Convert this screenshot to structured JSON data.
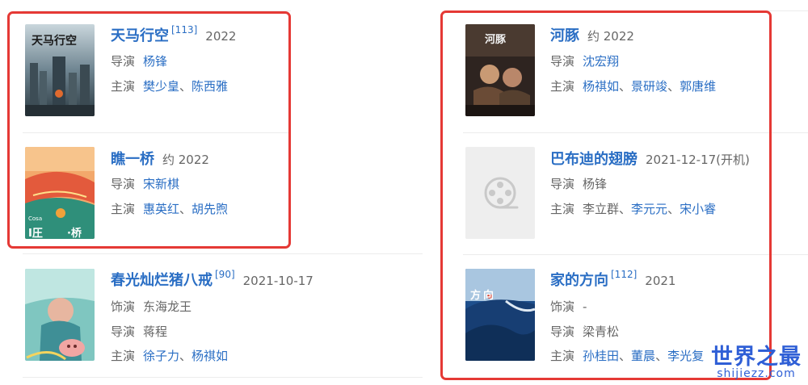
{
  "colors": {
    "link": "#2a6ec4",
    "muted": "#666666",
    "highlight": "#e53935",
    "watermark": "#2f5fd6"
  },
  "labels": {
    "director": "导演",
    "starring": "主演",
    "voice": "饰演",
    "separator": "、"
  },
  "films": [
    {
      "title": "天马行空",
      "ref": "[113]",
      "date": "2022",
      "director": [
        "杨锋"
      ],
      "director_links": true,
      "cast": [
        "樊少皇",
        "陈西雅"
      ],
      "cast_links": [
        true,
        true
      ]
    },
    {
      "title": "瞧一桥",
      "ref": "",
      "date": "约 2022",
      "director": [
        "宋新棋"
      ],
      "director_links": true,
      "cast": [
        "惠英红",
        "胡先煦"
      ],
      "cast_links": [
        true,
        true
      ]
    },
    {
      "title": "春光灿烂猪八戒",
      "ref": "[90]",
      "date": "2021-10-17",
      "voice": "东海龙王",
      "director": [
        "蒋程"
      ],
      "director_links": false,
      "cast": [
        "徐子力",
        "杨祺如"
      ],
      "cast_links": [
        true,
        true
      ]
    },
    {
      "title": "河豚",
      "ref": "",
      "date": "约 2022",
      "director": [
        "沈宏翔"
      ],
      "director_links": true,
      "cast": [
        "杨祺如",
        "景研竣",
        "郭唐维"
      ],
      "cast_links": [
        true,
        true,
        true
      ]
    },
    {
      "title": "巴布迪的翅膀",
      "ref": "",
      "date": "2021-12-17(开机)",
      "director": [
        "杨锋"
      ],
      "director_links": false,
      "cast": [
        "李立群",
        "李元元",
        "宋小睿"
      ],
      "cast_links": [
        false,
        true,
        true
      ]
    },
    {
      "title": "家的方向",
      "ref": "[112]",
      "date": "2021",
      "voice": "-",
      "director": [
        "梁青松"
      ],
      "director_links": false,
      "cast": [
        "孙桂田",
        "董晨",
        "李光复"
      ],
      "cast_links": [
        true,
        true,
        true
      ]
    }
  ],
  "posters": {
    "tianma": "天马行空",
    "hetun": "河豚",
    "qiao": [
      "Cosa",
      "I圧",
      "·桥"
    ],
    "jia": [
      "方",
      "向"
    ]
  },
  "watermark": {
    "name": "世界之最",
    "domain": "shijiezz.com"
  }
}
